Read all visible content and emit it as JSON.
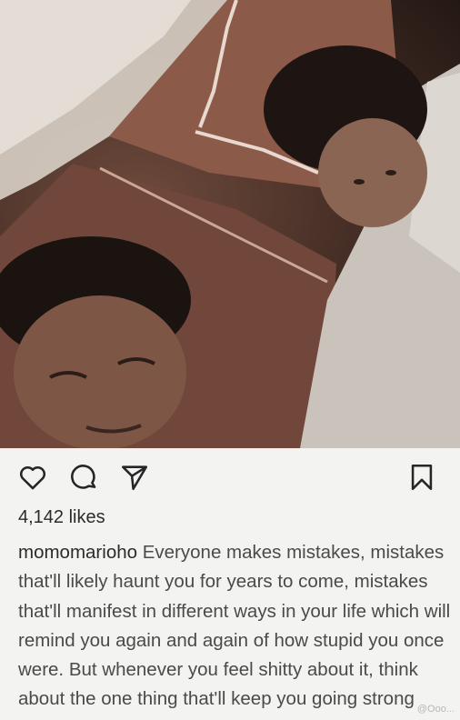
{
  "post": {
    "likes_text": "4,142 likes",
    "username": "momomarioho",
    "caption": "Everyone makes mistakes, mistakes that'll likely haunt you for years to come, mistakes that'll manifest in different ways in your life which will remind you again and again of how stupid you once were. But whenever you feel shitty about it, think about the one thing that'll keep you going strong"
  },
  "icons": {
    "like": "heart-icon",
    "comment": "comment-icon",
    "share": "paper-plane-icon",
    "save": "bookmark-icon"
  },
  "watermark": "@Ooo..."
}
